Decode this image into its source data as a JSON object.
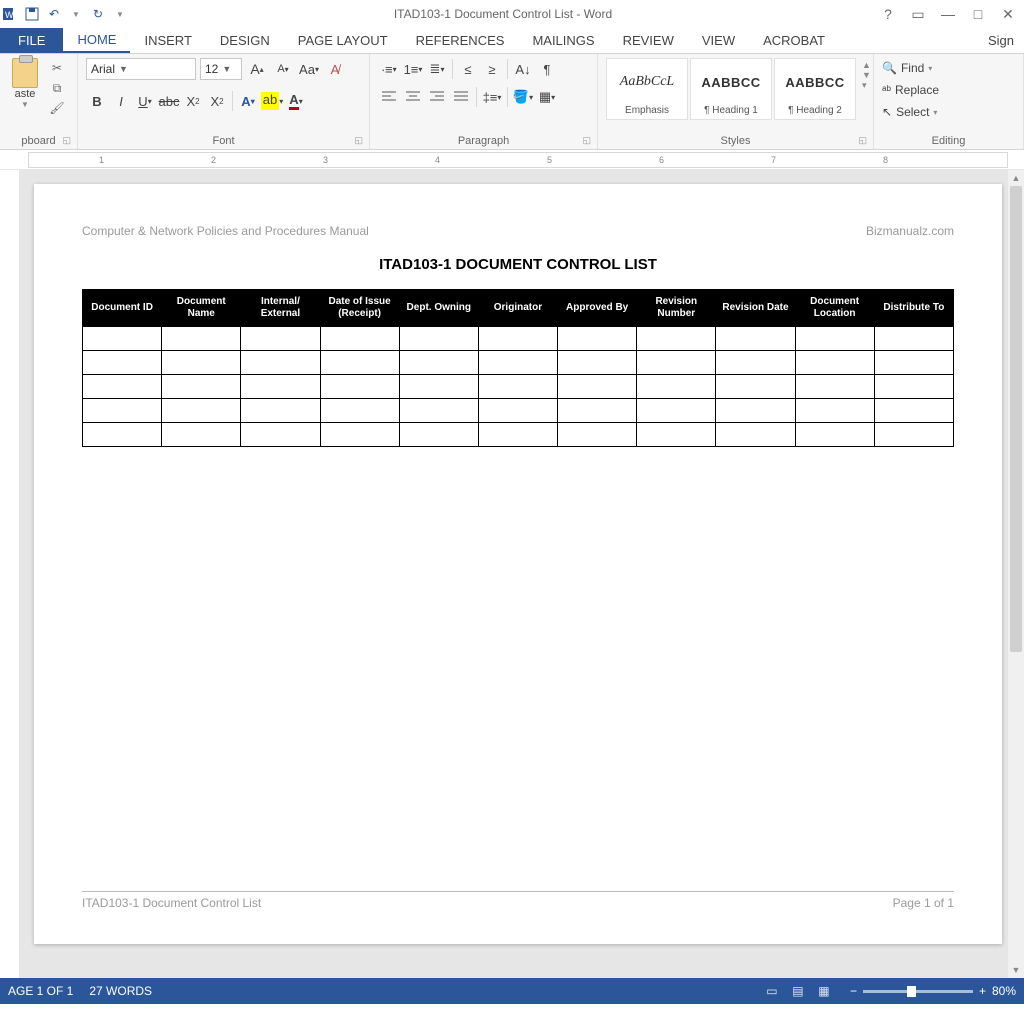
{
  "titlebar": {
    "title": "ITAD103-1 Document Control List - Word",
    "help": "?"
  },
  "tabs": {
    "file": "FILE",
    "items": [
      "HOME",
      "INSERT",
      "DESIGN",
      "PAGE LAYOUT",
      "REFERENCES",
      "MAILINGS",
      "REVIEW",
      "VIEW",
      "ACROBAT"
    ],
    "active": 0,
    "signin": "Sign"
  },
  "ribbon": {
    "clipboard": {
      "paste": "aste",
      "label": "pboard"
    },
    "font": {
      "name": "Arial",
      "size": "12",
      "label": "Font"
    },
    "paragraph": {
      "label": "Paragraph"
    },
    "styles": {
      "label": "Styles",
      "items": [
        {
          "preview": "AaBbCcL",
          "name": "Emphasis",
          "bold": false
        },
        {
          "preview": "AABBCC",
          "name": "¶ Heading 1",
          "bold": true
        },
        {
          "preview": "AABBCC",
          "name": "¶ Heading 2",
          "bold": true
        }
      ]
    },
    "editing": {
      "label": "Editing",
      "find": "Find",
      "replace": "Replace",
      "select": "Select"
    }
  },
  "ruler": {
    "marks": [
      "1",
      "2",
      "3",
      "4",
      "5",
      "6",
      "7",
      "8"
    ]
  },
  "document": {
    "header_left": "Computer & Network Policies and Procedures Manual",
    "header_right": "Bizmanualz.com",
    "title": "ITAD103-1   DOCUMENT CONTROL LIST",
    "columns": [
      "Document ID",
      "Document Name",
      "Internal/ External",
      "Date of Issue (Receipt)",
      "Dept. Owning",
      "Originator",
      "Approved By",
      "Revision Number",
      "Revision Date",
      "Document Location",
      "Distribute To"
    ],
    "rows": 5,
    "footer_left": "ITAD103-1 Document Control List",
    "footer_right": "Page 1 of 1"
  },
  "status": {
    "page": "AGE 1 OF 1",
    "words": "27 WORDS",
    "zoom": "80%"
  }
}
